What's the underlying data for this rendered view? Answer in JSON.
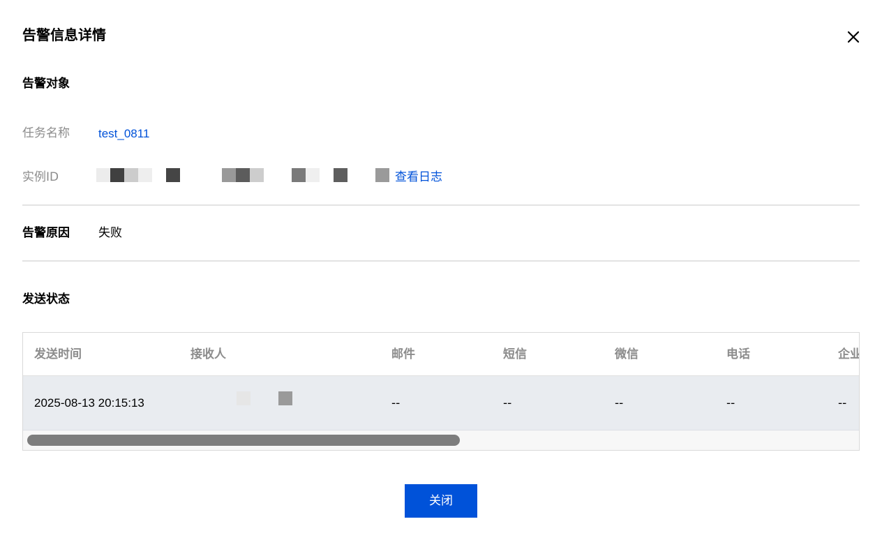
{
  "dialog": {
    "title": "告警信息详情",
    "close_icon": "close-icon"
  },
  "target": {
    "section_title": "告警对象",
    "task_label": "任务名称",
    "task_value": "test_0811",
    "instance_label": "实例ID",
    "view_log_label": "查看日志"
  },
  "reason": {
    "label": "告警原因",
    "value": "失败"
  },
  "send_status": {
    "section_title": "发送状态",
    "columns": [
      "发送时间",
      "接收人",
      "邮件",
      "短信",
      "微信",
      "电话",
      "企业"
    ],
    "rows": [
      {
        "time": "2025-08-13 20:15:13",
        "email": "--",
        "sms": "--",
        "wechat": "--",
        "phone": "--",
        "enterprise": "--"
      }
    ]
  },
  "footer": {
    "close_button_label": "关闭"
  },
  "colors": {
    "accent": "#0052d9",
    "row_bg": "#e9ecf0",
    "label_gray": "#8c8c8c"
  }
}
